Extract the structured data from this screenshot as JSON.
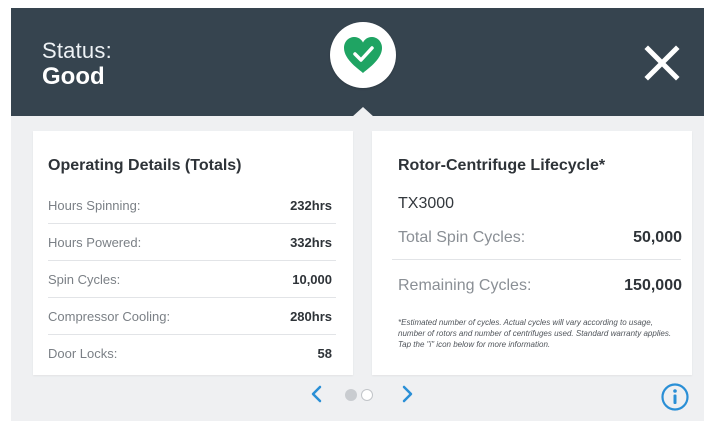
{
  "header": {
    "status_label": "Status:",
    "status_value": "Good",
    "status_icon": "heart-check-icon",
    "close_icon": "close-icon"
  },
  "colors": {
    "header_bg": "#36444f",
    "accent_green": "#1fa463",
    "accent_blue": "#2a8fd6",
    "panel_bg": "#eff0f2"
  },
  "operating": {
    "title": "Operating Details (Totals)",
    "rows": [
      {
        "label": "Hours Spinning:",
        "value": "232hrs"
      },
      {
        "label": "Hours Powered:",
        "value": "332hrs"
      },
      {
        "label": "Spin Cycles:",
        "value": "10,000"
      },
      {
        "label": "Compressor Cooling:",
        "value": "280hrs"
      },
      {
        "label": "Door Locks:",
        "value": "58"
      }
    ]
  },
  "lifecycle": {
    "title": "Rotor-Centrifuge Lifecycle*",
    "model": "TX3000",
    "total_label": "Total Spin Cycles:",
    "total_value": "50,000",
    "remaining_label": "Remaining Cycles:",
    "remaining_value": "150,000",
    "footnote": "*Estimated number of cycles. Actual cycles will vary according to usage, number of rotors and number of centrifuges used. Standard warranty applies. Tap the \"i\" icon below for more information."
  },
  "pager": {
    "current_page": 1,
    "page_count": 2,
    "prev_icon": "chevron-left-icon",
    "next_icon": "chevron-right-icon",
    "info_icon": "info-icon"
  }
}
